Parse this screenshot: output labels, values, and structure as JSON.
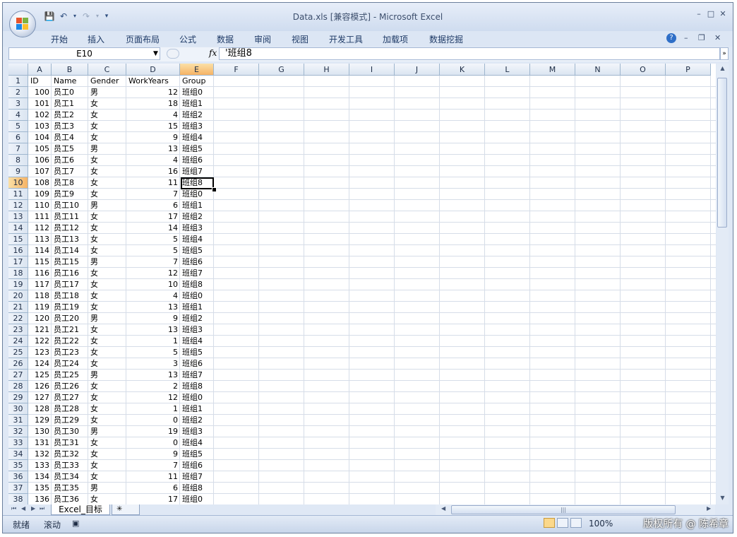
{
  "window": {
    "title": "Data.xls  [兼容模式] - Microsoft Excel"
  },
  "ribbon_tabs": [
    "开始",
    "插入",
    "页面布局",
    "公式",
    "数据",
    "审阅",
    "视图",
    "开发工具",
    "加载项",
    "数据挖掘"
  ],
  "formula_bar": {
    "name_box": "E10",
    "fx_label": "fx",
    "content": "'班组8"
  },
  "columns": [
    "A",
    "B",
    "C",
    "D",
    "E",
    "F",
    "G",
    "H",
    "I",
    "J",
    "K",
    "L",
    "M",
    "N",
    "O",
    "P"
  ],
  "selected_column": "E",
  "selected_row": 10,
  "active_cell": "E10",
  "header_row": [
    "ID",
    "Name",
    "Gender",
    "WorkYears",
    "Group"
  ],
  "rows": [
    [
      100,
      "员工0",
      "男",
      12,
      "班组0"
    ],
    [
      101,
      "员工1",
      "女",
      18,
      "班组1"
    ],
    [
      102,
      "员工2",
      "女",
      4,
      "班组2"
    ],
    [
      103,
      "员工3",
      "女",
      15,
      "班组3"
    ],
    [
      104,
      "员工4",
      "女",
      9,
      "班组4"
    ],
    [
      105,
      "员工5",
      "男",
      13,
      "班组5"
    ],
    [
      106,
      "员工6",
      "女",
      4,
      "班组6"
    ],
    [
      107,
      "员工7",
      "女",
      16,
      "班组7"
    ],
    [
      108,
      "员工8",
      "女",
      11,
      "班组8"
    ],
    [
      109,
      "员工9",
      "女",
      7,
      "班组0"
    ],
    [
      110,
      "员工10",
      "男",
      6,
      "班组1"
    ],
    [
      111,
      "员工11",
      "女",
      17,
      "班组2"
    ],
    [
      112,
      "员工12",
      "女",
      14,
      "班组3"
    ],
    [
      113,
      "员工13",
      "女",
      5,
      "班组4"
    ],
    [
      114,
      "员工14",
      "女",
      5,
      "班组5"
    ],
    [
      115,
      "员工15",
      "男",
      7,
      "班组6"
    ],
    [
      116,
      "员工16",
      "女",
      12,
      "班组7"
    ],
    [
      117,
      "员工17",
      "女",
      10,
      "班组8"
    ],
    [
      118,
      "员工18",
      "女",
      4,
      "班组0"
    ],
    [
      119,
      "员工19",
      "女",
      13,
      "班组1"
    ],
    [
      120,
      "员工20",
      "男",
      9,
      "班组2"
    ],
    [
      121,
      "员工21",
      "女",
      13,
      "班组3"
    ],
    [
      122,
      "员工22",
      "女",
      1,
      "班组4"
    ],
    [
      123,
      "员工23",
      "女",
      5,
      "班组5"
    ],
    [
      124,
      "员工24",
      "女",
      3,
      "班组6"
    ],
    [
      125,
      "员工25",
      "男",
      13,
      "班组7"
    ],
    [
      126,
      "员工26",
      "女",
      2,
      "班组8"
    ],
    [
      127,
      "员工27",
      "女",
      12,
      "班组0"
    ],
    [
      128,
      "员工28",
      "女",
      1,
      "班组1"
    ],
    [
      129,
      "员工29",
      "女",
      0,
      "班组2"
    ],
    [
      130,
      "员工30",
      "男",
      19,
      "班组3"
    ],
    [
      131,
      "员工31",
      "女",
      0,
      "班组4"
    ],
    [
      132,
      "员工32",
      "女",
      9,
      "班组5"
    ],
    [
      133,
      "员工33",
      "女",
      7,
      "班组6"
    ],
    [
      134,
      "员工34",
      "女",
      11,
      "班组7"
    ],
    [
      135,
      "员工35",
      "男",
      6,
      "班组8"
    ],
    [
      136,
      "员工36",
      "女",
      17,
      "班组0"
    ]
  ],
  "sheet_tabs": [
    "Excel_目标"
  ],
  "status_bar": {
    "ready": "就绪",
    "scroll": "滚动",
    "zoom": "100%",
    "watermark": "版权所有 @ 陈希章"
  },
  "icons": {
    "save": "save-icon",
    "undo": "undo-icon",
    "redo": "redo-icon",
    "help": "help-icon"
  }
}
